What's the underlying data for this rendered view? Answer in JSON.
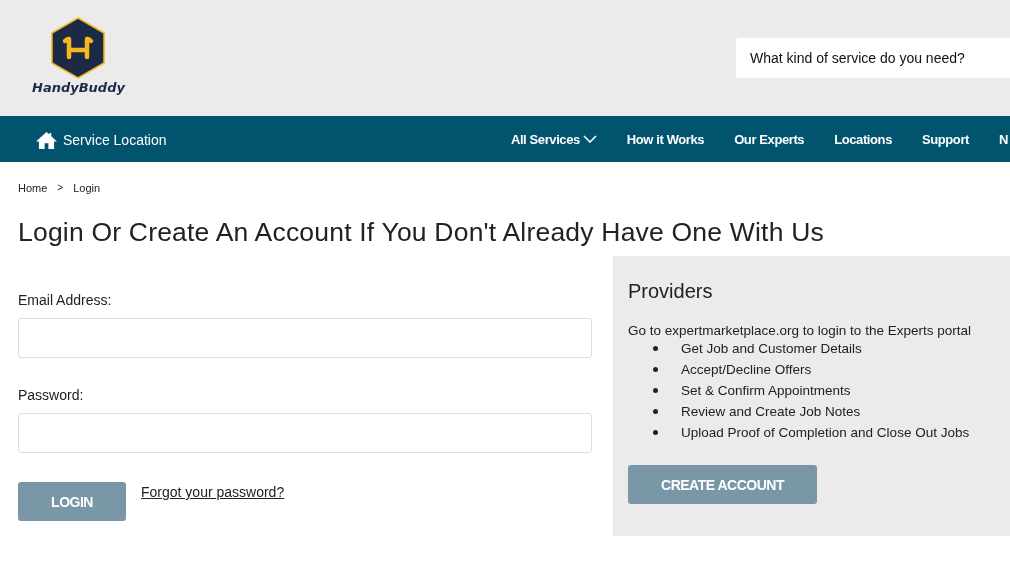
{
  "logo": {
    "name": "HandyBuddy"
  },
  "search": {
    "placeholder": "What kind of service do you need?"
  },
  "nav": {
    "location": "Service Location",
    "items": [
      {
        "label": "All Services",
        "dropdown": true
      },
      {
        "label": "How it Works",
        "dropdown": false
      },
      {
        "label": "Our Experts",
        "dropdown": false
      },
      {
        "label": "Locations",
        "dropdown": false
      },
      {
        "label": "Support",
        "dropdown": false
      },
      {
        "label": "N",
        "dropdown": false
      }
    ]
  },
  "breadcrumb": [
    "Home",
    "Login"
  ],
  "breadcrumb_separator": ">",
  "title": "Login Or Create An Account If You Don't Already Have One With Us",
  "form": {
    "fields": [
      {
        "label": "Email Address:"
      },
      {
        "label": "Password:"
      }
    ],
    "login": "LOGIN",
    "forgot": "Forgot your password?"
  },
  "providers": {
    "heading": "Providers",
    "intro": "Go to expertmarketplace.org to login to the Experts portal",
    "bullets": [
      "Get Job and Customer Details",
      "Accept/Decline Offers",
      "Set & Confirm Appointments",
      "Review and Create Job Notes",
      "Upload Proof of Completion and Close Out Jobs"
    ],
    "button": "CREATE ACCOUNT"
  }
}
